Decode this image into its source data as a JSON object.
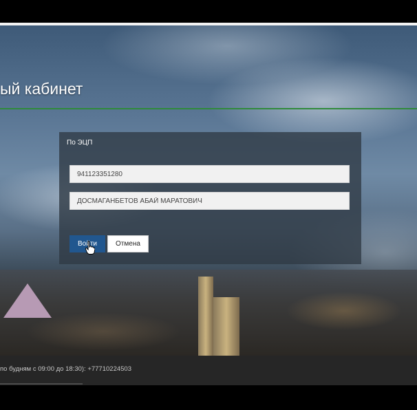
{
  "header": {
    "title": "ый кабинет"
  },
  "login_panel": {
    "title": "По ЭЦП",
    "iin_value": "941123351280",
    "name_value": "ДОСМАГАНБЕТОВ АБАЙ МАРАТОВИЧ",
    "login_label": "Войти",
    "cancel_label": "Отмена"
  },
  "footer": {
    "text": "по будням с 09:00 до 18:30): +77710224503"
  },
  "colors": {
    "accent_line": "#2f8a3a",
    "login_button": "#21578f",
    "footer_bg": "#262626"
  }
}
